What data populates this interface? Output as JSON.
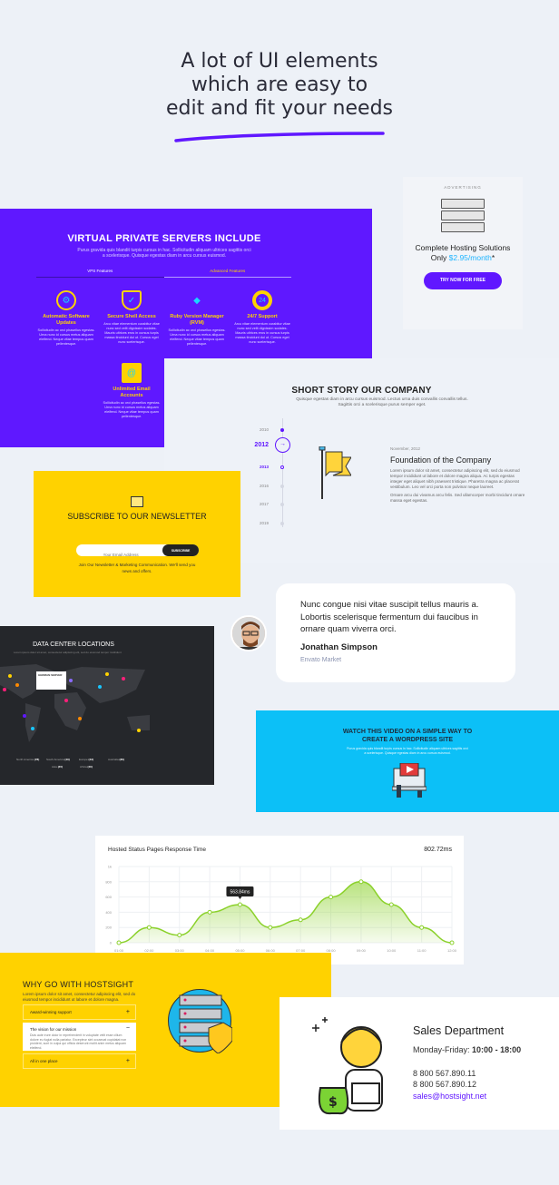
{
  "hero": {
    "lines": [
      "A lot of UI elements",
      "which are easy to",
      "edit and fit your needs"
    ],
    "underline_color": "#6017ff"
  },
  "vps": {
    "title": "VIRTUAL PRIVATE SERVERS INCLUDE",
    "subtitle": "Purus gravida quis blandit turpis cursus in hac. Sollicitudin aliquam ultrices sagittis orci a scelerisque. Quisque egestas diam in arcu cursus euismod.",
    "tabs": [
      {
        "label": "VPS Features",
        "active": false
      },
      {
        "label": "Advanced Features",
        "active": true
      }
    ],
    "features": [
      {
        "title": "Automatic Software Updates",
        "icon": "refresh-gear-icon",
        "text": "Sollicitudin ac orci phasellus egestas. Urna nunc id cursus metus aliquam eleifend. Neque vitae tempus quam pellentesque."
      },
      {
        "title": "Secure Shell Access",
        "icon": "shield-check-icon",
        "text": "Arcu vitae elementum curabitur vitae nunc sed velit dignissim sodales. Mauris ultrices eros in cursus turpis massa tincidunt dui ut. Cursus eget nunc scelerisque."
      },
      {
        "title": "Ruby Version Manager (RVM)",
        "icon": "diamond-icon",
        "text": "Sollicitudin ac orci phasellus egestas. Urna nunc id cursus metus aliquam eleifend. Neque vitae tempus quam pellentesque."
      },
      {
        "title": "24/7 Support",
        "icon": "lifebuoy-24-icon",
        "text": "Arcu vitae elementum curabitur vitae nunc sed velit dignissim sodales. Mauris ultrices eros in cursus turpis massa tincidunt dui ut. Cursus eget nunc scelerisque."
      },
      {
        "title": "Unlimited Email Accounts",
        "icon": "envelope-icon",
        "text": "Sollicitudin ac orci phasellus egestas. Urna nunc id cursus metus aliquam eleifend. Neque vitae tempus quam pellentesque."
      }
    ],
    "bg_color": "#5f18ff",
    "accent": "#ffd200"
  },
  "ad": {
    "label": "ADVERTISING",
    "text": "Complete Hosting Solutions Only",
    "price": "$2.95/month",
    "asterisk": "*",
    "button": "TRY NOW FOR FREE"
  },
  "story": {
    "title": "SHORT STORY OUR COMPANY",
    "subtitle": "Quisque egestas diam in arcu cursus euismod. Lectus urna duis convallis convallis tellus. Sagittis orci a scelerisque purus semper eget.",
    "years": [
      "2010",
      "2012",
      "2013",
      "2016",
      "2017",
      "2019"
    ],
    "active_year": "2012",
    "date": "November, 2012",
    "heading": "Foundation of the Company",
    "p1": "Lorem ipsum dolor sit amet, consectetur adipiscing elit, sed do eiusmod tempor incididunt ut labore et dolore magna aliqua. Ac turpis egestas integer eget aliquet nibh praesent tristique. Pharetra magna ac placerat vestibulum. Leo vel orci porta non pulvinar neque laoreet.",
    "p2": "Ornare arcu dui vivamus arcu felis. Sed ullamcorper morbi tincidunt ornare massa eget egestas."
  },
  "newsletter": {
    "title": "SUBSCRIBE TO OUR NEWSLETTER",
    "placeholder": "Your Email Address",
    "button": "SUBSCRIBE",
    "note": "Join Our Newsletter & Marketing Communication. We'll send you news and offers."
  },
  "testimonial": {
    "quote": "Nunc congue nisi vitae suscipit tellus mauris a. Lobortis scelerisque fermentum dui faucibus in ornare quam viverra orci.",
    "name": "Jonathan Simpson",
    "company": "Envato Market"
  },
  "datacenter": {
    "title": "DATA CENTER LOCATIONS",
    "subtitle": "Lorem ipsum dolor sit amet, consectetur adipiscing elit, sed do eiusmod tempor incididunt",
    "tooltip_title": "GERMAN SERVER",
    "legend": [
      {
        "label": "North America",
        "count": "(78)"
      },
      {
        "label": "South America",
        "count": "(43)"
      },
      {
        "label": "Europe",
        "count": "(43)"
      },
      {
        "label": "Australia",
        "count": "(36)"
      },
      {
        "label": "Asia",
        "count": "(45)"
      },
      {
        "label": "Africa",
        "count": "(40)"
      }
    ]
  },
  "video": {
    "title": "WATCH THIS VIDEO ON A SIMPLE WAY TO CREATE A WORDPRESS SITE",
    "subtitle": "Purus gravida quis blandit turpis cursus in hac. Sollicitudin aliquam ultrices sagittis orci a scelerisque. Quisque egestas diam in arcu cursus euismod.",
    "bg_color": "#0cc0f7"
  },
  "chart_data": {
    "type": "area",
    "title": "Hosted Status Pages Response Time",
    "headline_value": "802.72ms",
    "categories": [
      "01:00",
      "02:00",
      "03:00",
      "04:00",
      "05:00",
      "06:00",
      "07:00",
      "08:00",
      "09:00",
      "10:00",
      "11:00",
      "12:00"
    ],
    "values": [
      0,
      200,
      100,
      400,
      500,
      200,
      300,
      600,
      800,
      500,
      200,
      0
    ],
    "yticks": [
      "0",
      "200",
      "400",
      "600",
      "800",
      "1k"
    ],
    "ylim": [
      0,
      1000
    ],
    "tooltip": {
      "category": "05:00",
      "label": "563.84ms"
    },
    "grid": true,
    "color": "#8bd12b"
  },
  "why": {
    "title": "WHY GO WITH HOSTSIGHT",
    "subtitle": "Lorem ipsum dolor sit amet, consectetur adipiscing elit, sed do eiusmod tempor incididunt ut labore et dolore magna.",
    "items": [
      {
        "label": "Award-winning support",
        "open": false
      },
      {
        "label": "The vision for our mission",
        "open": true,
        "body": "Duis aute irure dolor in reprehenderit in voluptate velit esse cillum dolore eu fugiat nulla pariatur. Excepteur sint occaecat cupidatat non proident, sunt in culpa qui officia deserunt mollit anim metus aliquam eleifend."
      },
      {
        "label": "All in one place",
        "open": false
      }
    ]
  },
  "sales": {
    "title": "Sales Department",
    "hours_label": "Monday-Friday:",
    "hours": "10:00 - 18:00",
    "phones": [
      "8 800 567.890.11",
      "8 800 567.890.12"
    ],
    "email": "sales@hostsight.net"
  }
}
